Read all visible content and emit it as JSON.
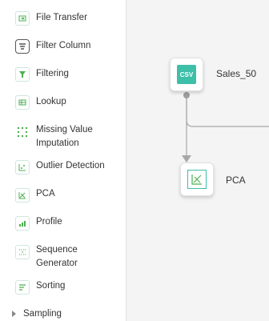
{
  "sidebar": {
    "items": [
      {
        "label": "File Transfer",
        "icon": "file-transfer-icon"
      },
      {
        "label": "Filter Column",
        "icon": "filter-column-icon"
      },
      {
        "label": "Filtering",
        "icon": "filter-icon"
      },
      {
        "label": "Lookup",
        "icon": "lookup-icon"
      },
      {
        "label": "Missing Value Imputation",
        "icon": "missing-value-icon"
      },
      {
        "label": "Outlier Detection",
        "icon": "outlier-detection-icon"
      },
      {
        "label": "PCA",
        "icon": "pca-icon"
      },
      {
        "label": "Profile",
        "icon": "profile-icon"
      },
      {
        "label": "Sequence Generator",
        "icon": "sequence-generator-icon"
      },
      {
        "label": "Sorting",
        "icon": "sorting-icon"
      }
    ],
    "group": {
      "label": "Sampling"
    }
  },
  "canvas": {
    "nodes": [
      {
        "label": "Sales_50",
        "badge": "CSV",
        "icon": "csv-icon"
      },
      {
        "label": "PCA",
        "icon": "pca-icon"
      }
    ]
  },
  "colors": {
    "accent": "#3dbfa8",
    "icon_green": "#4caf50",
    "connector": "#a8a8a8"
  }
}
